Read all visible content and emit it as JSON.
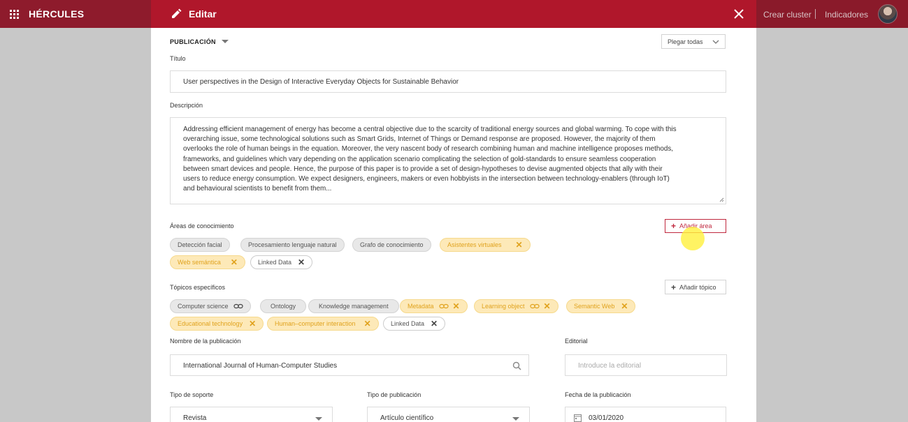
{
  "topbar": {
    "brand": "HÉRCULES",
    "edit_title": "Editar",
    "links": [
      "Crear cluster",
      "Indicadores"
    ]
  },
  "form": {
    "section": "PUBLICACIÓN",
    "collapse_all": "Plegar todas",
    "title_label": "Título",
    "title_value": "User perspectives in the Design of Interactive Everyday Objects for Sustainable Behavior",
    "description_label": "Descripción",
    "description_lines": [
      "Addressing efficient management of energy has become a central objective due to the scarcity of traditional energy sources and global warming. To cope with this",
      "overarching issue, some technological solutions such as Smart Grids, Internet of Things or Demand response are proposed. However, the majority of them",
      "overlooks the role of human beings in the equation. Moreover, the very nascent body of research combining human and machine intelligence proposes methods,",
      "frameworks, and guidelines which vary depending on the application scenario complicating the selection of gold-standards to ensure seamless cooperation",
      "between smart devices and people. Hence, the purpose of this paper is to provide a set of design-hypotheses to devise augmented objects that ally with their",
      "users to reduce energy consumption. We expect designers, engineers, makers or even hobbyists in the intersection between technology-enablers (through IoT)",
      "and behavioural scientists to benefit from them..."
    ],
    "areas_label": "Áreas de conocimiento",
    "add_area": "Añadir área",
    "areas": [
      {
        "label": "Detección facial",
        "style": "grey"
      },
      {
        "label": "Procesamiento lenguaje natural",
        "style": "grey"
      },
      {
        "label": "Grafo de conocimiento",
        "style": "grey"
      },
      {
        "label": "Asistentes virtuales",
        "style": "yellow"
      },
      {
        "label": "Web semántica",
        "style": "yellow"
      },
      {
        "label": "Linked Data",
        "style": "white"
      }
    ],
    "topics_label": "Tópicos específicos",
    "add_topic": "Añadir tópico",
    "topics": [
      {
        "label": "Computer science",
        "style": "grey"
      },
      {
        "label": "Ontology",
        "style": "grey"
      },
      {
        "label": "Knowledge management",
        "style": "grey"
      },
      {
        "label": "Metadata",
        "style": "yellow"
      },
      {
        "label": "Learning object",
        "style": "yellow"
      },
      {
        "label": "Semantic Web",
        "style": "yellow"
      },
      {
        "label": "Educational technology",
        "style": "yellow"
      },
      {
        "label": "Human–computer interaction",
        "style": "yellow"
      },
      {
        "label": "Linked Data",
        "style": "white"
      }
    ],
    "pub_name_label": "Nombre de la publicación",
    "pub_name_value": "International Journal of Human-Computer Studies",
    "editorial_label": "Editorial",
    "editorial_placeholder": "Introduce la editorial",
    "support_label": "Tipo de soporte",
    "support_value": "Revista",
    "pub_type_label": "Tipo de publicación",
    "pub_type_value": "Artículo científico",
    "date_label": "Fecha de la publicación",
    "date_value": "03/01/2020"
  },
  "colors": {
    "brand_dark": "#8a1a2a",
    "brand": "#b0172b",
    "chip_yellow": "#fde9b8",
    "chip_yellow_text": "#e0a21d"
  }
}
